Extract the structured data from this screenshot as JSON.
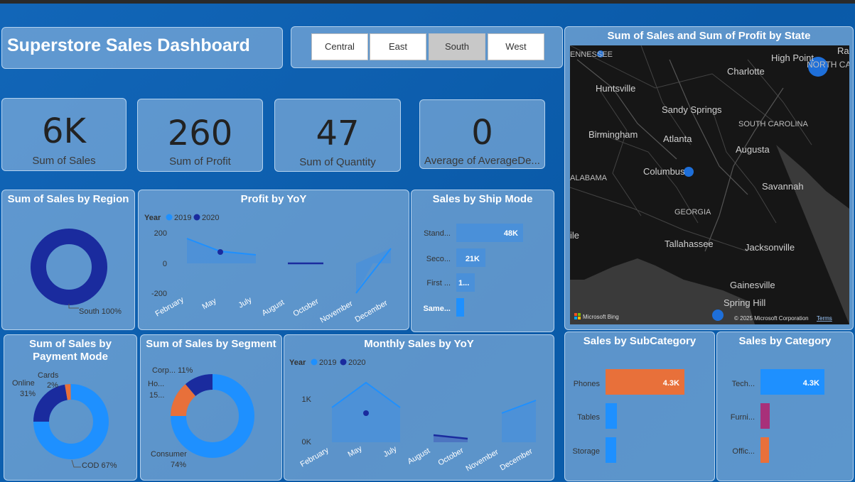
{
  "title": "Superstore Sales Dashboard",
  "region_slicer": {
    "options": [
      "Central",
      "East",
      "South",
      "West"
    ],
    "selected": "South"
  },
  "kpis": [
    {
      "value": "6K",
      "label": "Sum of Sales"
    },
    {
      "value": "260",
      "label": "Sum of Profit"
    },
    {
      "value": "47",
      "label": "Sum of Quantity"
    },
    {
      "value": "0",
      "label": "Average of AverageDe..."
    }
  ],
  "sales_by_region": {
    "title": "Sum of Sales by Region",
    "slice_label": "South 100%"
  },
  "profit_by_yoy": {
    "title": "Profit by YoY",
    "legend_title": "Year",
    "legend": [
      "2019",
      "2020"
    ],
    "y_ticks": [
      "200",
      "0",
      "-200"
    ],
    "x_ticks": [
      "February",
      "May",
      "July",
      "August",
      "October",
      "November",
      "December"
    ]
  },
  "ship_mode": {
    "title": "Sales by Ship Mode",
    "rows": [
      {
        "label": "Stand...",
        "value": "48K"
      },
      {
        "label": "Seco...",
        "value": "21K"
      },
      {
        "label": "First ...",
        "value": "1..."
      },
      {
        "label": "Same...",
        "value": ""
      }
    ]
  },
  "map": {
    "title": "Sum of Sales and Sum of Profit by State",
    "labels": [
      "ENNESSEE",
      "High Point",
      "NORTH CA",
      "Ra",
      "Charlotte",
      "Huntsville",
      "Sandy Springs",
      "Birmingham",
      "Atlanta",
      "SOUTH CAROLINA",
      "Augusta",
      "ALABAMA",
      "Columbus",
      "Savannah",
      "GEORGIA",
      "ile",
      "Tallahassee",
      "Jacksonville",
      "Gainesville",
      "Spring Hill"
    ],
    "attribution": "Microsoft Bing",
    "copyright": "© 2025 Microsoft Corporation",
    "terms": "Terms"
  },
  "payment_mode": {
    "title": "Sum of Sales by Payment Mode",
    "labels": [
      "Cards",
      "2%",
      "Online",
      "31%",
      "COD 67%"
    ]
  },
  "segment": {
    "title": "Sum of Sales by Segment",
    "labels": [
      "Corp... 11%",
      "Ho...",
      "15...",
      "Consumer",
      "74%"
    ]
  },
  "monthly_sales": {
    "title": "Monthly Sales by YoY",
    "legend_title": "Year",
    "legend": [
      "2019",
      "2020"
    ],
    "y_ticks": [
      "1K",
      "0K"
    ],
    "x_ticks": [
      "February",
      "May",
      "July",
      "August",
      "October",
      "November",
      "December"
    ]
  },
  "subcategory": {
    "title": "Sales by SubCategory",
    "rows": [
      {
        "label": "Phones",
        "value": "4.3K"
      },
      {
        "label": "Tables",
        "value": ""
      },
      {
        "label": "Storage",
        "value": ""
      }
    ]
  },
  "category": {
    "title": "Sales by Category",
    "rows": [
      {
        "label": "Tech...",
        "value": "4.3K"
      },
      {
        "label": "Furni...",
        "value": ""
      },
      {
        "label": "Offic...",
        "value": ""
      }
    ]
  },
  "colors": {
    "series_2019": "#1e90ff",
    "series_2020": "#1a2b9e",
    "accent_orange": "#e8703a",
    "accent_magenta": "#a8307a"
  }
}
